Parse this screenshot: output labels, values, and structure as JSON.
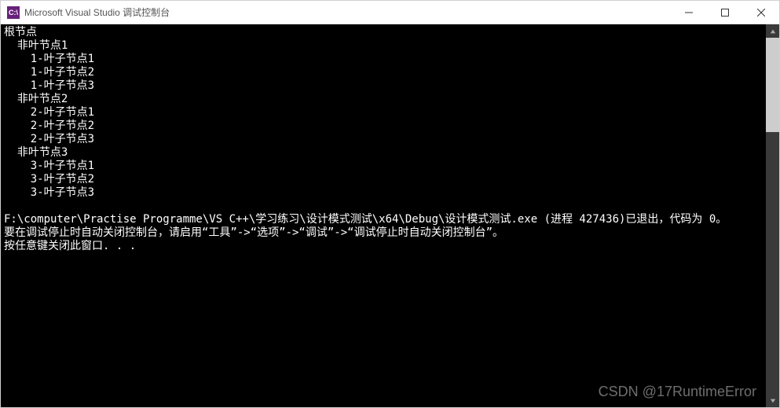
{
  "titlebar": {
    "icon_label": "C:\\",
    "title": "Microsoft Visual Studio 调试控制台"
  },
  "console": {
    "lines": [
      "根节点",
      "  非叶节点1",
      "    1-叶子节点1",
      "    1-叶子节点2",
      "    1-叶子节点3",
      "  非叶节点2",
      "    2-叶子节点1",
      "    2-叶子节点2",
      "    2-叶子节点3",
      "  非叶节点3",
      "    3-叶子节点1",
      "    3-叶子节点2",
      "    3-叶子节点3",
      "",
      "F:\\computer\\Practise Programme\\VS C++\\学习练习\\设计模式测试\\x64\\Debug\\设计模式测试.exe (进程 427436)已退出，代码为 0。",
      "要在调试停止时自动关闭控制台，请启用“工具”->“选项”->“调试”->“调试停止时自动关闭控制台”。",
      "按任意键关闭此窗口. . ."
    ]
  },
  "watermark": "CSDN @17RuntimeError"
}
